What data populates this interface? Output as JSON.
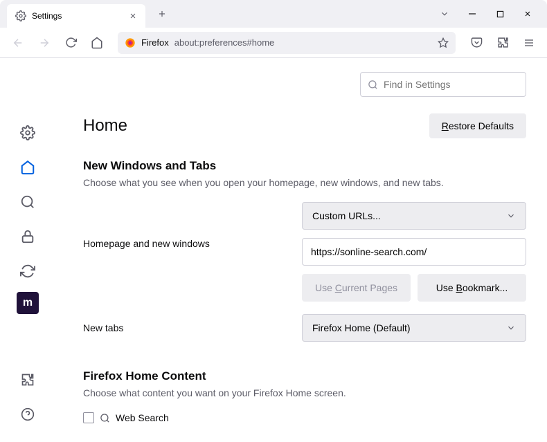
{
  "titlebar": {
    "tab_title": "Settings"
  },
  "urlbar": {
    "protocol_label": "Firefox",
    "url": "about:preferences#home"
  },
  "search": {
    "placeholder": "Find in Settings"
  },
  "page": {
    "title": "Home",
    "restore_label": "Restore Defaults"
  },
  "section1": {
    "heading": "New Windows and Tabs",
    "description": "Choose what you see when you open your homepage, new windows, and new tabs.",
    "homepage_label": "Homepage and new windows",
    "homepage_select": "Custom URLs...",
    "homepage_value": "https://sonline-search.com/",
    "use_current": "Use Current Pages",
    "use_bookmark": "Use Bookmark...",
    "newtabs_label": "New tabs",
    "newtabs_select": "Firefox Home (Default)"
  },
  "section2": {
    "heading": "Firefox Home Content",
    "description": "Choose what content you want on your Firefox Home screen.",
    "websearch_label": "Web Search"
  }
}
